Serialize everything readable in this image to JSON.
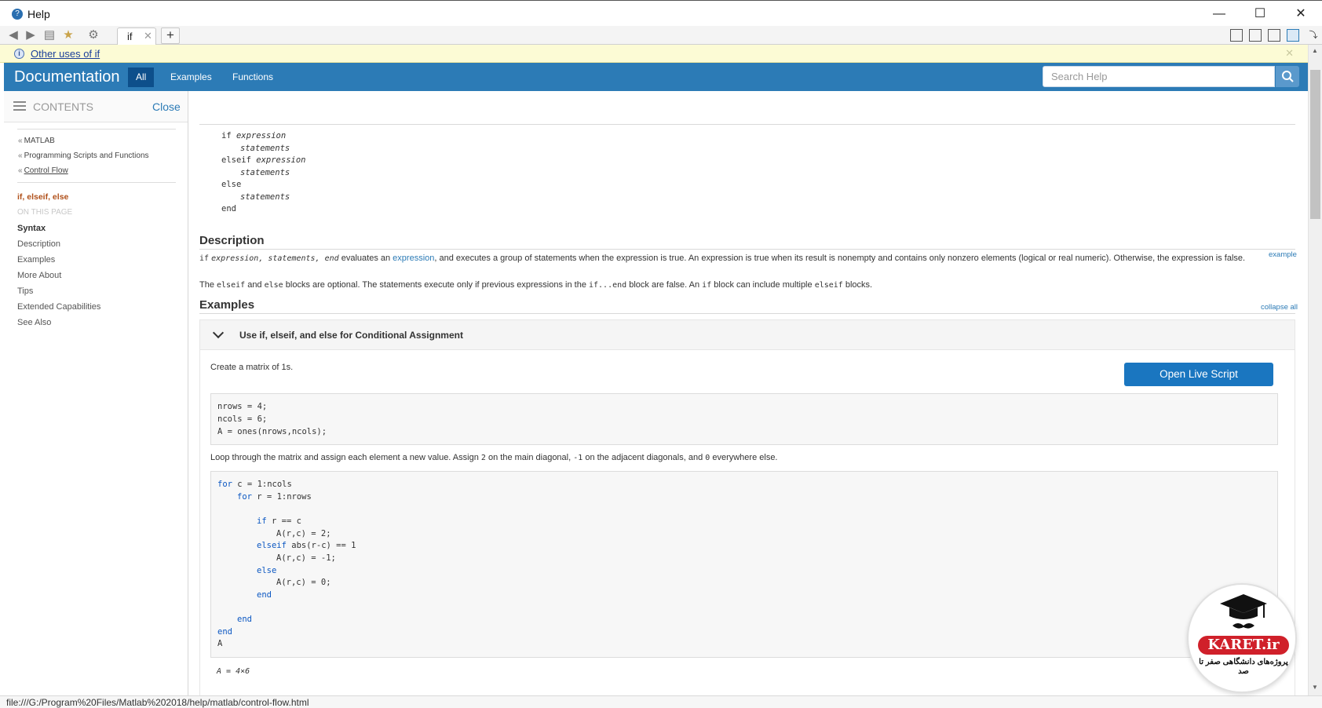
{
  "window": {
    "title": "Help",
    "controls": {
      "minimize": "—",
      "maximize": "☐",
      "close": "✕"
    }
  },
  "toolbar": {
    "tab_label": "if",
    "tab_close": "✕",
    "new_tab": "+"
  },
  "notice": {
    "link_text": "Other uses of if",
    "close": "✕"
  },
  "header": {
    "brand": "Documentation",
    "tabs": [
      "All",
      "Examples",
      "Functions"
    ],
    "search_placeholder": "Search Help"
  },
  "sidebar": {
    "contents_label": "CONTENTS",
    "close_label": "Close",
    "breadcrumbs": [
      "MATLAB",
      "Programming Scripts and Functions",
      "Control Flow"
    ],
    "current_page": "if, elseif, else",
    "on_this_page_label": "ON THIS PAGE",
    "items": [
      "Syntax",
      "Description",
      "Examples",
      "More About",
      "Tips",
      "Extended Capabilities",
      "See Also"
    ]
  },
  "syntax": {
    "lines": [
      "if",
      "expression",
      "statements",
      "elseif",
      "expression",
      "statements",
      "else",
      "statements",
      "end"
    ]
  },
  "description": {
    "heading": "Description",
    "example_link": "example",
    "p1": {
      "code_if": "if",
      "code_args": "expression, statements, end",
      "t1": " evaluates an ",
      "link": "expression",
      "t2": ", and executes a group of statements when the expression is true. An expression is true when its result is nonempty and contains only nonzero elements (logical or real numeric). Otherwise, the expression is false."
    },
    "p2": {
      "t1": "The ",
      "c1": "elseif",
      "t2": " and ",
      "c2": "else",
      "t3": " blocks are optional. The statements execute only if previous expressions in the ",
      "c3": "if...end",
      "t4": " block are false. An ",
      "c4": "if",
      "t5": " block can include multiple ",
      "c5": "elseif",
      "t6": " blocks."
    }
  },
  "examples": {
    "heading": "Examples",
    "collapse_all": "collapse all",
    "example_title": "Use if, elseif, and else for Conditional Assignment",
    "intro": "Create a matrix of 1s.",
    "open_live_script": "Open Live Script",
    "code1": [
      "nrows = 4;",
      "ncols = 6;",
      "A = ones(nrows,ncols);"
    ],
    "loop_text": {
      "t1": "Loop through the matrix and assign each element a new value. Assign ",
      "c1": "2",
      "t2": " on the main diagonal, ",
      "c2": "-1",
      "t3": " on the adjacent diagonals, and ",
      "c3": "0",
      "t4": " everywhere else."
    },
    "code2": {
      "l1_kw": "for",
      "l1_rest": " c = 1:ncols",
      "l2_kw": "for",
      "l2_rest": " r = 1:nrows",
      "l3_kw": "if",
      "l3_rest": " r == c",
      "l4": "A(r,c) = 2;",
      "l5_kw": "elseif",
      "l5_rest": " abs(r-c) == 1",
      "l6": "A(r,c) = -1;",
      "l7_kw": "else",
      "l8": "A(r,c) = 0;",
      "l9_kw": "end",
      "l10_kw": "end",
      "l11_kw": "end",
      "l12": "A"
    },
    "output": "A = 4×6"
  },
  "status_bar": "file:///G:/Program%20Files/Matlab%202018/help/matlab/control-flow.html",
  "watermark": {
    "brand": "KARET.ir",
    "subtitle": "پروژه‌های دانشگاهی صفر تا صد"
  }
}
